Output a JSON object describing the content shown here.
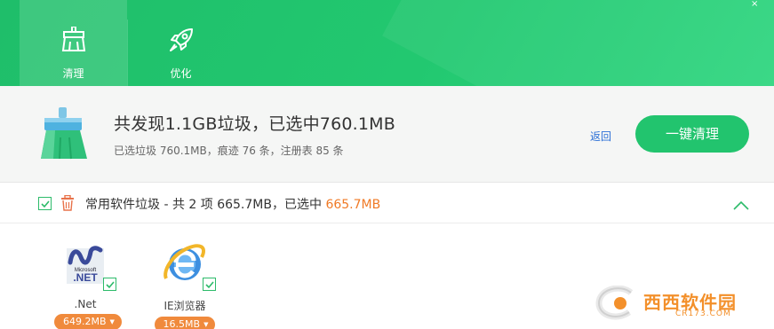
{
  "header": {
    "tabs": [
      {
        "label": "清理",
        "icon": "broom-icon",
        "active": true
      },
      {
        "label": "优化",
        "icon": "rocket-icon",
        "active": false
      }
    ],
    "close_glyph": "×",
    "accent_color": "#22c46e"
  },
  "summary": {
    "title": "共发现1.1GB垃圾，已选中760.1MB",
    "subtitle": "已选垃圾 760.1MB，痕迹 76 条，注册表 85 条",
    "back_label": "返回",
    "clean_button_label": "一键清理"
  },
  "category": {
    "label_prefix": "常用软件垃圾 - 共 2 项 665.7MB，已选中 ",
    "selected_size": "665.7MB",
    "highlight_color": "#f07a26",
    "checked": true,
    "expanded": true
  },
  "items": [
    {
      "name": ".Net",
      "size": "649.2MB",
      "icon": "dotnet-icon",
      "checked": true
    },
    {
      "name": "IE浏览器",
      "size": "16.5MB",
      "icon": "ie-icon",
      "checked": true
    }
  ],
  "watermark": {
    "text": "西西软件园",
    "sub": "CR173.COM"
  }
}
